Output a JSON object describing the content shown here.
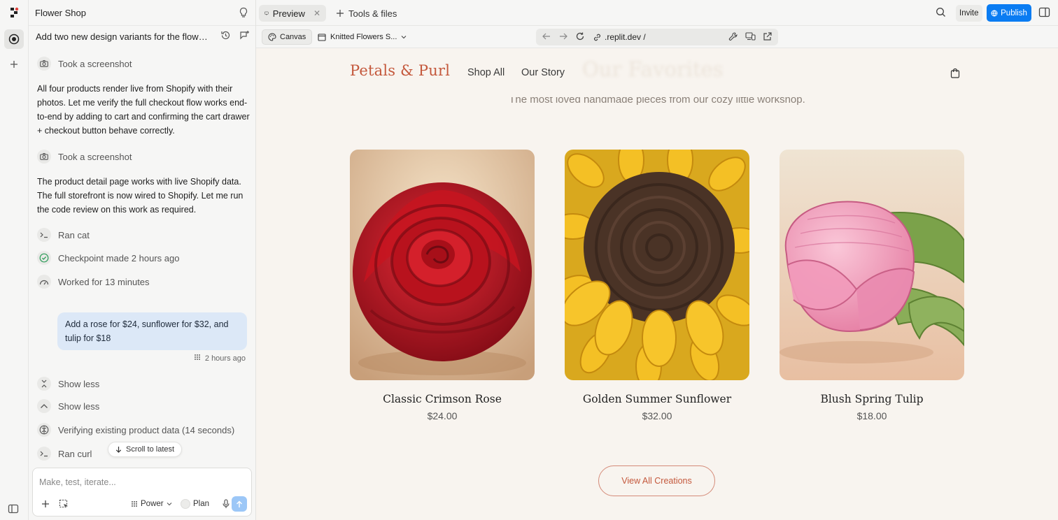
{
  "chat": {
    "project_title": "Flower Shop",
    "topic": "Add two new design variants for the flowe...",
    "steps": [
      {
        "label": "Took a screenshot"
      },
      {
        "label": "Took a screenshot"
      },
      {
        "label": "Ran cat"
      },
      {
        "label": "Checkpoint made 2 hours ago"
      },
      {
        "label": "Worked for 13 minutes"
      },
      {
        "label": "Show less"
      },
      {
        "label": "Show less"
      },
      {
        "label": "Verifying existing product data (14 seconds)"
      },
      {
        "label": "Ran curl"
      }
    ],
    "messages": [
      "All four products render live from Shopify with their photos. Let me verify the full checkout flow works end-to-end by adding to cart and confirming the cart drawer + checkout button behave correctly.",
      "The product detail page works with live Shopify data. The full storefront is now wired to Shopify. Let me run the code review on this work as required."
    ],
    "user_message": "Add a rose for $24, sunflower for $32, and tulip for $18",
    "user_message_time": "2 hours ago",
    "scroll_label": "Scroll to latest",
    "composer": {
      "placeholder": "Make, test, iterate...",
      "mode": "Power",
      "plan_label": "Plan"
    }
  },
  "topbar": {
    "tabs": [
      {
        "label": "Preview"
      },
      {
        "label": "Tools & files"
      }
    ],
    "invite_label": "Invite",
    "publish_label": "Publish"
  },
  "urlbar": {
    "canvas_label": "Canvas",
    "project_label": "Knitted Flowers S...",
    "url": ".replit.dev /"
  },
  "site": {
    "brand": "Petals & Purl",
    "nav": [
      "Shop All",
      "Our Story"
    ],
    "ghost_heading": "Our Favorites",
    "subtitle": "The most loved handmade pieces from our cozy little workshop.",
    "products": [
      {
        "name": "Classic Crimson Rose",
        "price": "$24.00"
      },
      {
        "name": "Golden Summer Sunflower",
        "price": "$32.00"
      },
      {
        "name": "Blush Spring Tulip",
        "price": "$18.00"
      }
    ],
    "cta_label": "View All Creations"
  },
  "colors": {
    "brand": "#c4583c",
    "publish": "#0a7cf2",
    "user_bubble": "#dce8f7",
    "site_bg": "#f8f4ef"
  }
}
